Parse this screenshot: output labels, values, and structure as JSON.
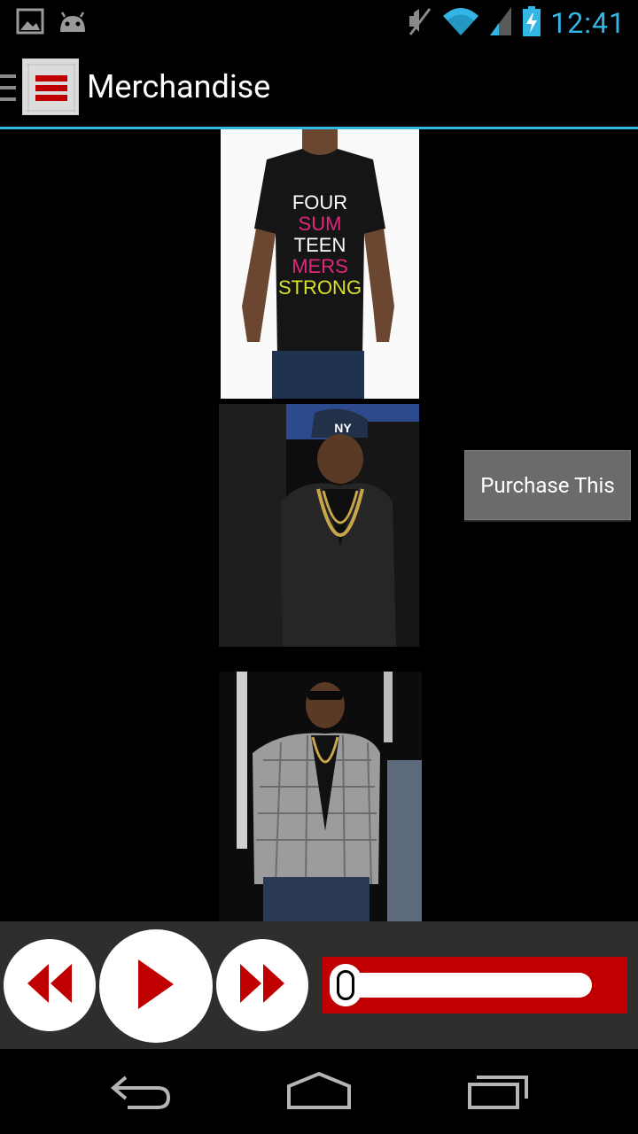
{
  "status_bar": {
    "time": "12:41",
    "icons": [
      "image-notification-icon",
      "android-notification-icon",
      "mute-icon",
      "wifi-icon",
      "signal-icon",
      "battery-charging-icon"
    ]
  },
  "action_bar": {
    "title": "Merchandise",
    "app_icon": "app-logo-icon",
    "nav_indicator": "drawer-indicator-icon"
  },
  "content": {
    "purchase_label": "Purchase This",
    "shirt_text": [
      "FOUR",
      "SUM",
      "TEEN",
      "MERS",
      "STRONG"
    ],
    "cap_text": "NY",
    "photos": [
      "tshirt-product-photo",
      "leather-jacket-photo",
      "plaid-blazer-photo"
    ]
  },
  "player": {
    "controls": [
      "rewind-icon",
      "play-icon",
      "fast-forward-icon"
    ],
    "progress": 0.0
  },
  "nav_bar": {
    "buttons": [
      "back-icon",
      "home-icon",
      "recent-apps-icon"
    ]
  }
}
